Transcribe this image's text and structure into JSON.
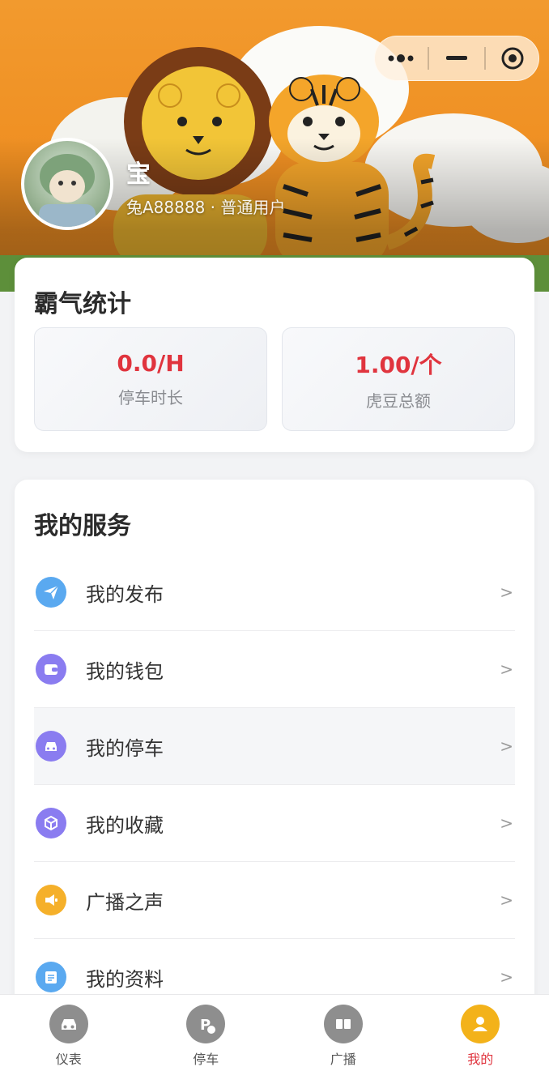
{
  "header": {
    "user_name": "宝",
    "user_sub": "兔A88888 · 普通用户"
  },
  "capsule": {
    "more_icon": "more-dots-icon",
    "minimize_icon": "minimize-icon",
    "close_icon": "target-circle-icon"
  },
  "stats": {
    "title": "霸气统计",
    "items": [
      {
        "value": "0.0/H",
        "label": "停车时长"
      },
      {
        "value": "1.00/个",
        "label": "虎豆总额"
      }
    ]
  },
  "services": {
    "title": "我的服务",
    "items": [
      {
        "label": "我的发布",
        "icon": "paper-plane-icon",
        "color": "#5aa9f0",
        "arrow": ">"
      },
      {
        "label": "我的钱包",
        "icon": "wallet-icon",
        "color": "#8a7cf0",
        "arrow": ">"
      },
      {
        "label": "我的停车",
        "icon": "car-icon",
        "color": "#8a7cf0",
        "arrow": ">"
      },
      {
        "label": "我的收藏",
        "icon": "cube-icon",
        "color": "#8a7cf0",
        "arrow": ">"
      },
      {
        "label": "广播之声",
        "icon": "megaphone-icon",
        "color": "#f5b02a",
        "arrow": ">"
      },
      {
        "label": "我的资料",
        "icon": "edit-note-icon",
        "color": "#5aa9f0",
        "arrow": ">"
      }
    ]
  },
  "tabbar": {
    "items": [
      {
        "label": "仪表",
        "icon": "car-icon",
        "active": false
      },
      {
        "label": "停车",
        "icon": "parking-icon",
        "active": false
      },
      {
        "label": "广播",
        "icon": "book-icon",
        "active": false
      },
      {
        "label": "我的",
        "icon": "user-icon",
        "active": true
      }
    ]
  },
  "colors": {
    "accent": "#e0343e",
    "banner": "#ef8f22",
    "active_tab": "#f3b21a"
  }
}
